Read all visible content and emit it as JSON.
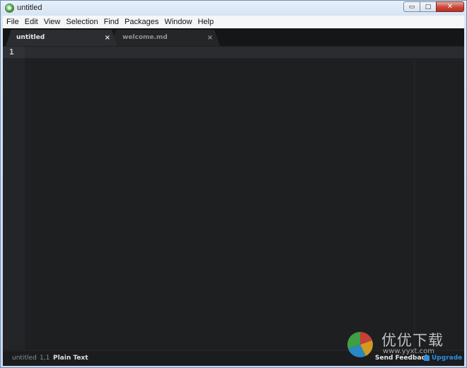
{
  "window": {
    "title": "untitled",
    "controls": {
      "minimize": "▭",
      "maximize": "□",
      "close": "✕"
    }
  },
  "menu": [
    "File",
    "Edit",
    "View",
    "Selection",
    "Find",
    "Packages",
    "Window",
    "Help"
  ],
  "tabs": [
    {
      "label": "untitled",
      "close": "×",
      "active": true
    },
    {
      "label": "welcome.md",
      "close": "×",
      "active": false
    }
  ],
  "editor": {
    "line_numbers": [
      "1"
    ]
  },
  "status": {
    "file": "untitled",
    "position": "1,1",
    "syntax": "Plain Text",
    "feedback": "Send Feedback",
    "upgrade": "Upgrade"
  },
  "watermark": {
    "text": "优优下载",
    "url": "www.yyxt.com"
  },
  "colors": {
    "editor_bg": "#1e1f21",
    "accent": "#2e8ee0"
  }
}
